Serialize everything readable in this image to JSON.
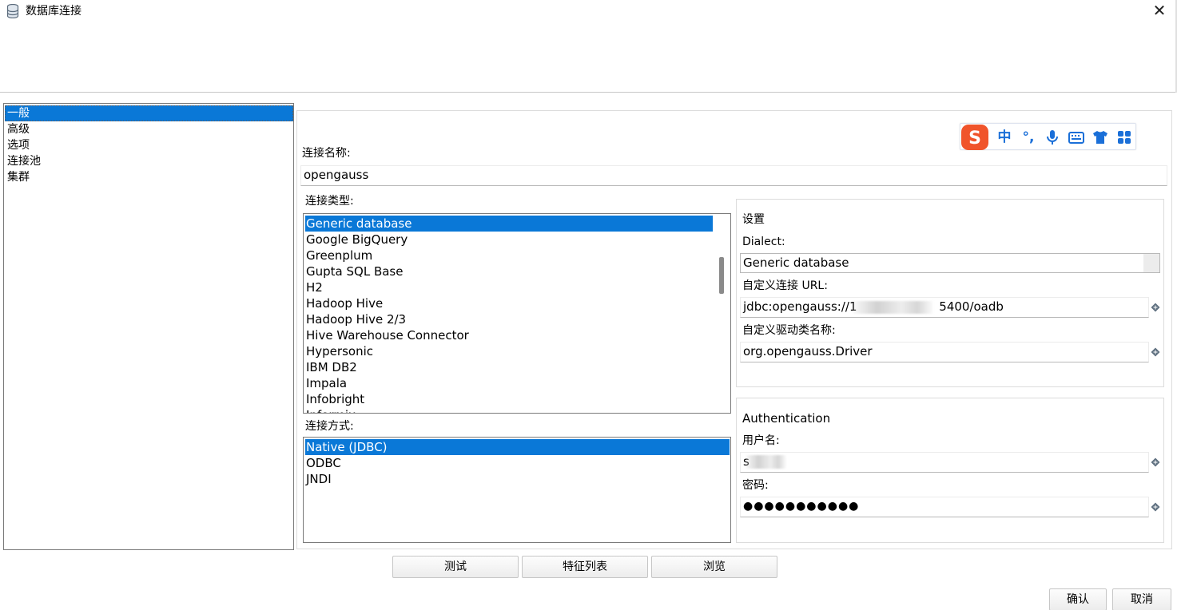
{
  "window": {
    "title": "数据库连接",
    "close_glyph": "✕"
  },
  "nav": {
    "items": [
      {
        "label": "一般",
        "selected": true
      },
      {
        "label": "高级",
        "selected": false
      },
      {
        "label": "选项",
        "selected": false
      },
      {
        "label": "连接池",
        "selected": false
      },
      {
        "label": "集群",
        "selected": false
      }
    ]
  },
  "ime": {
    "logo": "S",
    "mode": "中",
    "punct": "°,",
    "icons": [
      "sogou-logo-icon",
      "chinese-mode-icon",
      "punctuation-icon",
      "microphone-icon",
      "keyboard-icon",
      "skin-shirt-icon",
      "toolbox-icon"
    ]
  },
  "connection": {
    "name_label": "连接名称:",
    "name_value": "opengauss",
    "type_label": "连接类型:",
    "types": [
      "Generic database",
      "Google BigQuery",
      "Greenplum",
      "Gupta SQL Base",
      "H2",
      "Hadoop Hive",
      "Hadoop Hive 2/3",
      "Hive Warehouse Connector",
      "Hypersonic",
      "IBM DB2",
      "Impala",
      "Infobright",
      "Informix"
    ],
    "selected_type": "Generic database",
    "method_label": "连接方式:",
    "methods": [
      "Native (JDBC)",
      "ODBC",
      "JNDI"
    ],
    "selected_method": "Native (JDBC)"
  },
  "settings": {
    "title": "设置",
    "dialect_label": "Dialect:",
    "dialect_value": "Generic database",
    "url_label": "自定义连接 URL:",
    "url_prefix": "jdbc:opengauss://1",
    "url_suffix": "5400/oadb",
    "driver_label": "自定义驱动类名称:",
    "driver_value": "org.opengauss.Driver"
  },
  "auth": {
    "title": "Authentication",
    "user_label": "用户名:",
    "user_value": "s",
    "password_label": "密码:",
    "password_value": "●●●●●●●●●●●"
  },
  "buttons": {
    "test": "测试",
    "features": "特征列表",
    "explore": "浏览",
    "ok": "确认",
    "cancel": "取消"
  },
  "colors": {
    "selection": "#0a78d7",
    "ime_accent": "#1a6fd8",
    "sogou_orange": "#f0542b"
  }
}
